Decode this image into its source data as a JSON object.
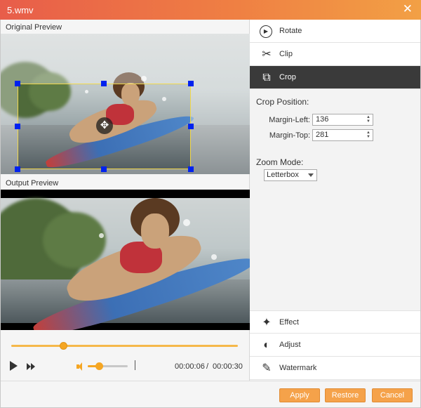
{
  "window": {
    "title": "5.wmv",
    "close_glyph": "✕"
  },
  "preview": {
    "original_label": "Original Preview",
    "output_label": "Output Preview",
    "move_glyph": "✥"
  },
  "playback": {
    "progress": 0.23,
    "volume": 0.28,
    "current_time": "00:00:06",
    "separator": "/",
    "total_time": "00:00:30"
  },
  "menu": {
    "items": [
      {
        "label": "Rotate",
        "icon": "rotate-icon",
        "glyph": "▶"
      },
      {
        "label": "Clip",
        "icon": "scissors-icon",
        "glyph": "✂"
      },
      {
        "label": "Crop",
        "icon": "crop-icon",
        "glyph": "⧉",
        "active": true
      },
      {
        "label": "Effect",
        "icon": "sparkle-icon",
        "glyph": "✦"
      },
      {
        "label": "Adjust",
        "icon": "brightness-icon",
        "glyph": "◐"
      },
      {
        "label": "Watermark",
        "icon": "brush-icon",
        "glyph": "✎"
      }
    ]
  },
  "crop": {
    "position_title": "Crop Position:",
    "margin_left_label": "Margin-Left:",
    "margin_left_value": "136",
    "margin_top_label": "Margin-Top:",
    "margin_top_value": "281",
    "zoom_title": "Zoom Mode:",
    "zoom_value": "Letterbox"
  },
  "buttons": {
    "apply": "Apply",
    "restore": "Restore",
    "cancel": "Cancel"
  },
  "colors": {
    "accent": "#f5a24a",
    "title_start": "#e85d4a",
    "title_end": "#f2a045",
    "handle": "#0022ee"
  }
}
